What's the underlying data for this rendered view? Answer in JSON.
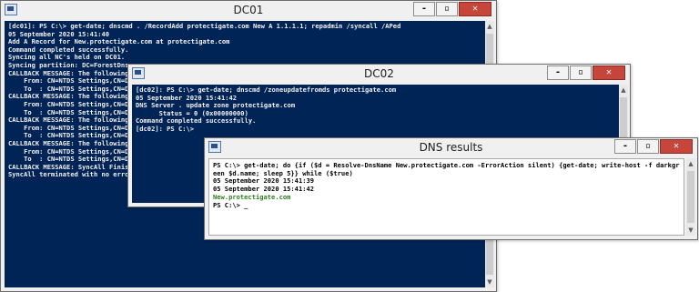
{
  "dc01": {
    "title": "DC01",
    "lines": [
      "[dc01]: PS C:\\> get-date; dnscmd . /RecordAdd protectigate.com New A 1.1.1.1; repadmin /syncall /APed",
      "",
      "05 September 2020 15:41:40",
      "",
      "Add A Record for New.protectigate.com at protectigate.com",
      "Command completed successfully.",
      "",
      "Syncing all NC's held on DC01.",
      "",
      "Syncing partition: DC=ForestDns",
      "",
      "CALLBACK MESSAGE: The following",
      "",
      "    From: CN=NTDS Settings,CN=D",
      "",
      "    To  : CN=NTDS Settings,CN=D",
      "",
      "CALLBACK MESSAGE: The following",
      "",
      "    From: CN=NTDS Settings,CN=D",
      "",
      "    To  : CN=NTDS Settings,CN=D",
      "",
      "CALLBACK MESSAGE: The following",
      "",
      "    From: CN=NTDS Settings,CN=D",
      "",
      "    To  : CN=NTDS Settings,CN=DC03,CN=Servers,CN=",
      "",
      "CALLBACK MESSAGE: The following replication comple",
      "",
      "    From: CN=NTDS Settings,CN=DC01,CN=Servers,CN=N",
      "",
      "    To  : CN=NTDS Settings,CN=DC02,CN=Servers,CN=CA,CN=Sites,CN=Configuration,DC=protectigate,DC=com",
      "",
      "CALLBACK MESSAGE: SyncAll Finished.",
      "",
      "SyncAll terminated with no errors."
    ]
  },
  "dc02": {
    "title": "DC02",
    "lines": [
      "[dc02]: PS C:\\> get-date; dnscmd /zoneupdatefromds protectigate.com",
      "",
      "05 September 2020 15:41:42",
      "",
      "DNS Server . update zone protectigate.com",
      "      Status = 0 (0x00000000)",
      "Command completed successfully.",
      "",
      "",
      "[dc02]: PS C:\\>"
    ]
  },
  "dns": {
    "title": "DNS results",
    "lines": [
      {
        "text": "PS C:\\> get-date; do {if ($d = Resolve-DnsName New.protectigate.com -ErrorAction silent) {get-date; write-host -f darkgr",
        "color": "default"
      },
      {
        "text": "een $d.name; sleep 5}} while ($true)",
        "color": "default"
      },
      {
        "text": "",
        "color": "default"
      },
      {
        "text": "05 September 2020 15:41:39",
        "color": "default"
      },
      {
        "text": "05 September 2020 15:41:42",
        "color": "default"
      },
      {
        "text": "New.protectigate.com",
        "color": "green"
      },
      {
        "text": "PS C:\\> _",
        "color": "default"
      }
    ]
  },
  "window_buttons": {
    "minimize": "-",
    "maximize": "▫",
    "close": "✕"
  }
}
